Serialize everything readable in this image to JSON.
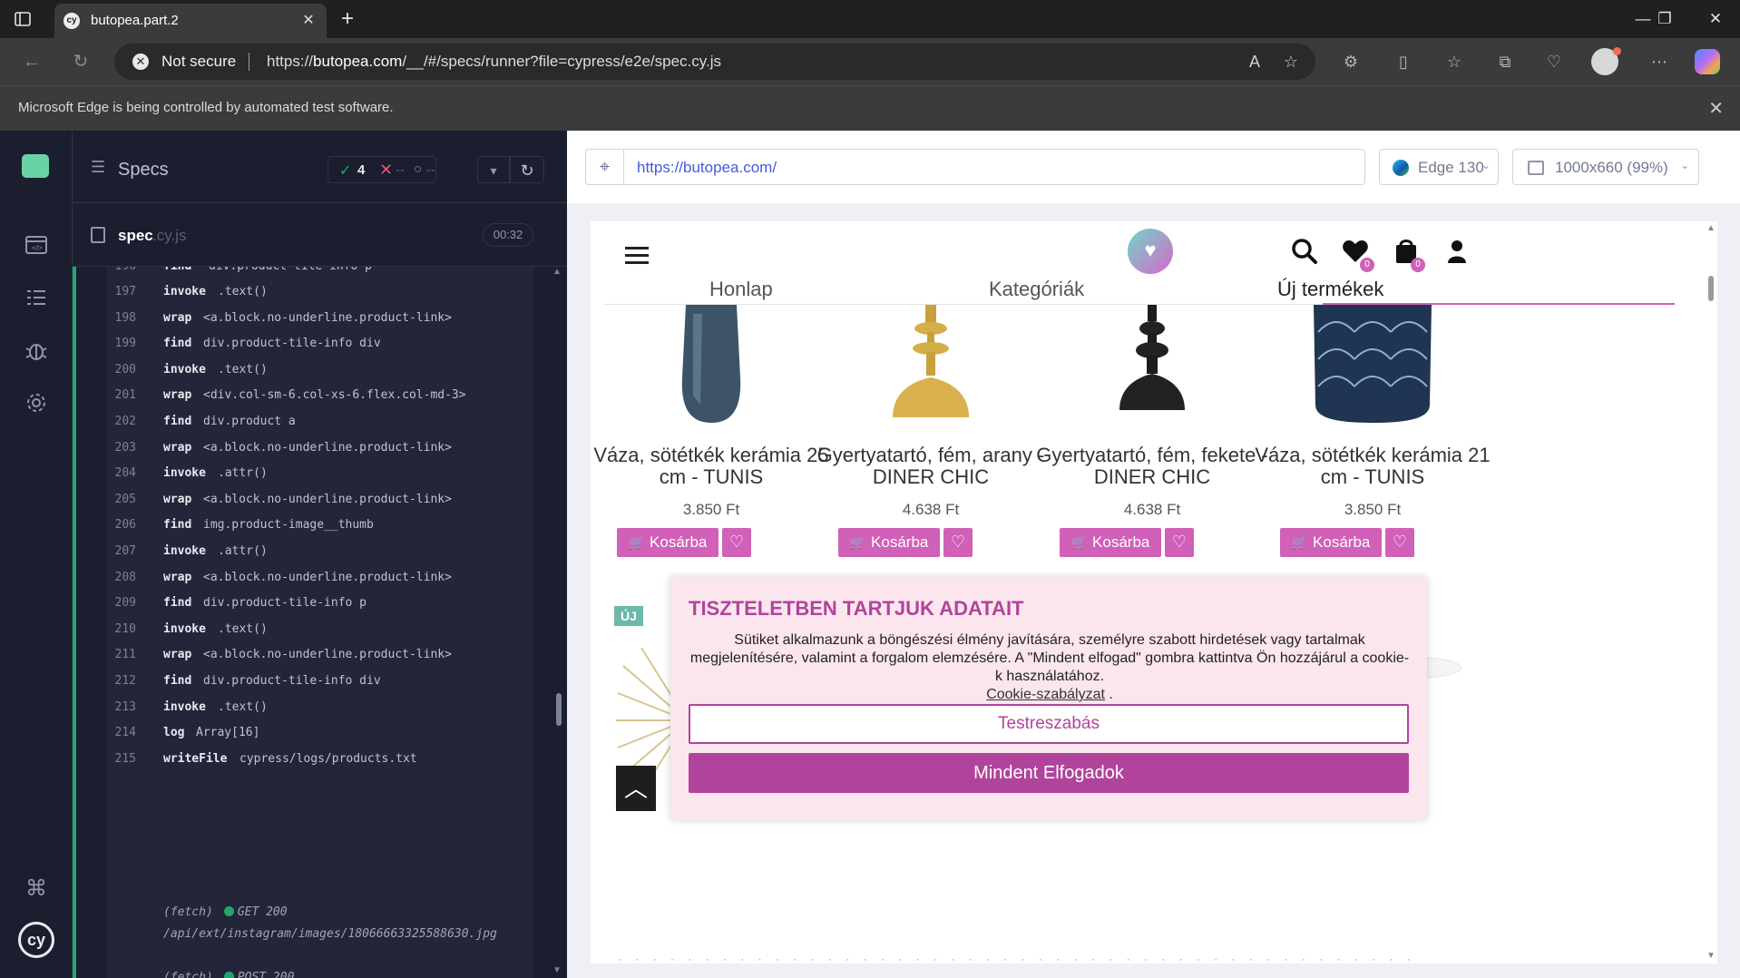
{
  "browser": {
    "tab_title": "butopea.part.2",
    "favicon_text": "cy",
    "tab_close": "✕",
    "new_tab": "+",
    "window_controls": {
      "minimize": "—",
      "maximize": "❐",
      "close": "✕"
    },
    "security_label": "Not secure",
    "url_host_prefix": "https://",
    "url_host": "butopea.com",
    "url_rest": "/__/#/specs/runner?file=cypress/e2e/spec.cy.js",
    "infobar_text": "Microsoft Edge is being controlled by automated test software.",
    "infobar_close": "✕"
  },
  "reporter": {
    "specs_label": "Specs",
    "stats": {
      "passed": "4",
      "failed": "--",
      "pending": "--"
    },
    "spec_name": "spec",
    "spec_ext": ".cy.js",
    "duration": "00:32",
    "commands": [
      {
        "num": "197",
        "name": "invoke",
        "msg": ".text()"
      },
      {
        "num": "198",
        "name": "wrap",
        "msg": "<a.block.no-underline.product-link>"
      },
      {
        "num": "199",
        "name": "find",
        "msg": "div.product-tile-info div"
      },
      {
        "num": "200",
        "name": "invoke",
        "msg": ".text()"
      },
      {
        "num": "201",
        "name": "wrap",
        "msg": "<div.col-sm-6.col-xs-6.flex.col-md-3>"
      },
      {
        "num": "202",
        "name": "find",
        "msg": "div.product a"
      },
      {
        "num": "203",
        "name": "wrap",
        "msg": "<a.block.no-underline.product-link>"
      },
      {
        "num": "204",
        "name": "invoke",
        "msg": ".attr()"
      },
      {
        "num": "205",
        "name": "wrap",
        "msg": "<a.block.no-underline.product-link>"
      },
      {
        "num": "206",
        "name": "find",
        "msg": "img.product-image__thumb"
      },
      {
        "num": "207",
        "name": "invoke",
        "msg": ".attr()"
      },
      {
        "num": "208",
        "name": "wrap",
        "msg": "<a.block.no-underline.product-link>"
      },
      {
        "num": "209",
        "name": "find",
        "msg": "div.product-tile-info p"
      },
      {
        "num": "210",
        "name": "invoke",
        "msg": ".text()"
      },
      {
        "num": "211",
        "name": "wrap",
        "msg": "<a.block.no-underline.product-link>"
      },
      {
        "num": "212",
        "name": "find",
        "msg": "div.product-tile-info div"
      },
      {
        "num": "213",
        "name": "invoke",
        "msg": ".text()"
      },
      {
        "num": "214",
        "name": "log",
        "msg": "Array[16]"
      },
      {
        "num": "215",
        "name": "writeFile",
        "msg": "cypress/logs/products.txt"
      }
    ],
    "fetch_1": {
      "label": "(fetch)",
      "status": "GET 200",
      "path": "/api/ext/instagram/images/18066663325588630.jpg"
    },
    "fetch_2": {
      "label": "(fetch)",
      "status": "POST 200"
    }
  },
  "aut": {
    "url": "https://butopea.com/",
    "browser": "Edge 130",
    "viewport": "1000x660 (99%)"
  },
  "site": {
    "tabs": [
      "Honlap",
      "Kategóriák",
      "Új termékek"
    ],
    "wishlist_count": "0",
    "cart_count": "0",
    "products": [
      {
        "title": "Váza, sötétkék kerámia 25 cm - TUNIS",
        "price": "3.850 Ft",
        "cart_label": "Kosárba"
      },
      {
        "title": "Gyertyatartó, fém, arany - DINER CHIC",
        "price": "4.638 Ft",
        "cart_label": "Kosárba"
      },
      {
        "title": "Gyertyatartó, fém, fekete - DINER CHIC",
        "price": "4.638 Ft",
        "cart_label": "Kosárba"
      },
      {
        "title": "Váza, sötétkék kerámia 21 cm - TUNIS",
        "price": "3.850 Ft",
        "cart_label": "Kosárba"
      }
    ],
    "new_badge": "ÚJ",
    "cookie": {
      "title": "TISZTELETBEN TARTJUK ADATAIT",
      "text": "Sütiket alkalmazunk a böngészési élmény javítására, személyre szabott hirdetések vagy tartalmak megjelenítésére, valamint a forgalom elemzésére. A \"Mindent elfogad\" gombra kattintva Ön hozzájárul a cookie-k használatához.",
      "policy_link": "Cookie-szabályzat",
      "policy_suffix": " .",
      "customize": "Testreszabás",
      "accept_all": "Mindent Elfogadok"
    }
  },
  "colors": {
    "cypress_bg": "#1b1e2e",
    "pass_green": "#1fa971",
    "brand_pink": "#d060b8",
    "cookie_purple": "#b0449c",
    "cookie_bg": "#fbe6ee"
  }
}
